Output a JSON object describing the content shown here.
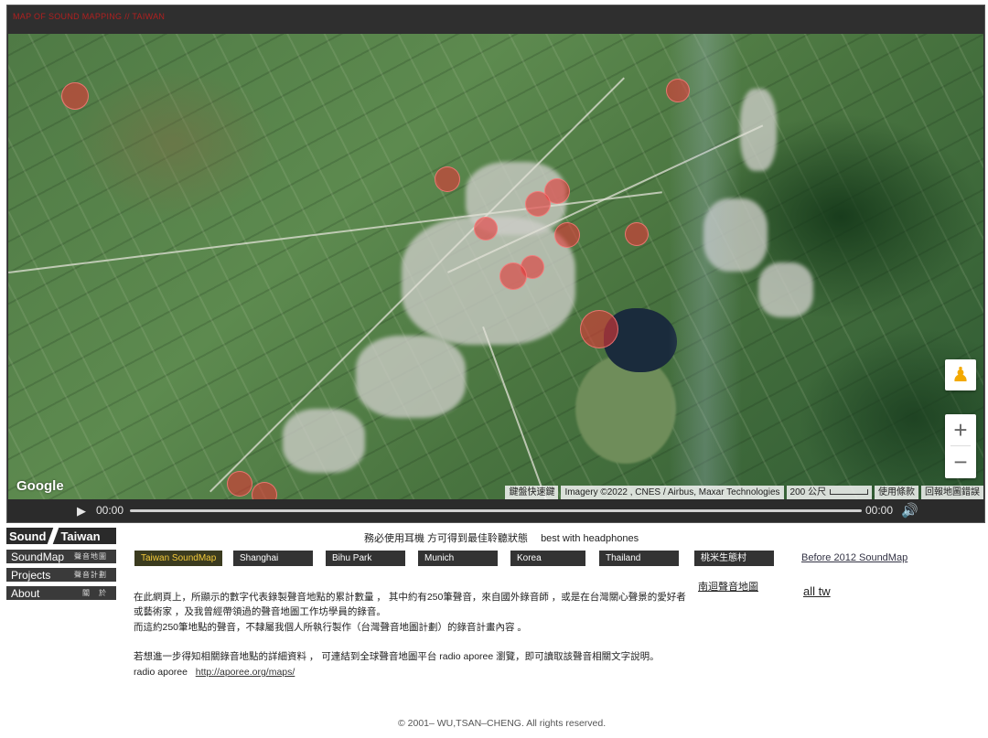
{
  "map": {
    "title": "MAP OF SOUND MAPPING // TAIWAN",
    "google_logo": "Google",
    "attribution": {
      "keyboard": "鍵盤快速鍵",
      "imagery": "Imagery ©2022 , CNES / Airbus, Maxar Technologies",
      "scale": "200 公尺",
      "terms": "使用條款",
      "report": "回報地圖錯誤"
    },
    "controls": {
      "pegman_icon": "pegman-icon",
      "zoom_in": "+",
      "zoom_out": "−"
    }
  },
  "player": {
    "play_icon": "▶",
    "current_time": "00:00",
    "duration": "00:00",
    "volume_icon": "🔊",
    "progress": 0
  },
  "sidebar": {
    "logo_left": "Sound",
    "logo_right": "Taiwan",
    "items": [
      {
        "label": "SoundMap",
        "zh": "聲音地圖"
      },
      {
        "label": "Projects",
        "zh": "聲音計劃"
      },
      {
        "label": "About",
        "zh": "關　於"
      }
    ]
  },
  "notice": {
    "zh": "務必使用耳機  方可得到最佳聆聽狀態",
    "en": "best with headphones"
  },
  "tabs": [
    {
      "label": "Taiwan SoundMap",
      "active": true
    },
    {
      "label": "Shanghai"
    },
    {
      "label": "Bihu Park"
    },
    {
      "label": "Munich"
    },
    {
      "label": "Korea"
    },
    {
      "label": "Thailand"
    },
    {
      "label": "桃米生態村"
    }
  ],
  "links": {
    "before_2012": "Before 2012 SoundMap",
    "nanhui": "南迴聲音地圖",
    "all_tw": "all tw"
  },
  "description": {
    "line1": "在此網頁上，所顯示的數字代表錄製聲音地點的累計數量 ， 其中約有250筆聲音，來自國外錄音師 ，或是在台灣關心聲景的愛好者",
    "line2": "或藝術家 ，及我曾經帶領過的聲音地圖工作坊學員的錄音。",
    "line3": "而這約250筆地點的聲音，不隸屬我個人所執行製作（台灣聲音地圖計劃）的錄音計畫內容 。",
    "line4": "若想進一步得知相關錄音地點的詳細資料 ， 可連結到全球聲音地圖平台 radio aporee 瀏覽，即可讀取該聲音相關文字說明。",
    "line5_label": "radio aporee",
    "line5_url": "http://aporee.org/maps/"
  },
  "footer": {
    "copyright": "© 2001–  WU,TSAN–CHENG. All rights reserved."
  },
  "colors": {
    "marker": "#e13737",
    "active_tab_text": "#f2c93a",
    "dark_panel": "#2f2f2f"
  }
}
